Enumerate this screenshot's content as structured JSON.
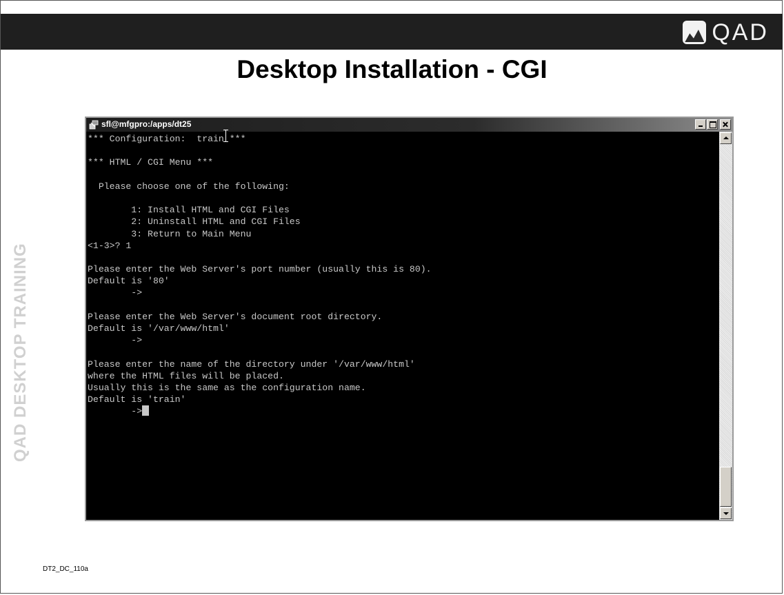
{
  "header": {
    "logo_text": "QAD",
    "logo_icon": "qad-mountain-logo-icon"
  },
  "slide": {
    "title": "Desktop Installation - CGI",
    "side_label": "QAD DESKTOP TRAINING",
    "footer_code": "DT2_DC_110a"
  },
  "window": {
    "title": "sfl@mfgpro:/apps/dt25",
    "icon": "putty-terminal-icon",
    "buttons": [
      "minimize",
      "maximize",
      "close"
    ]
  },
  "terminal": {
    "lines": [
      "*** Configuration:  train ***",
      "",
      "*** HTML / CGI Menu ***",
      "",
      "  Please choose one of the following:",
      "",
      "        1: Install HTML and CGI Files",
      "        2: Uninstall HTML and CGI Files",
      "        3: Return to Main Menu",
      "<1-3>? 1",
      "",
      "Please enter the Web Server's port number (usually this is 80).",
      "Default is '80'",
      "        ->",
      "",
      "Please enter the Web Server's document root directory.",
      "Default is '/var/www/html'",
      "        ->",
      "",
      "Please enter the name of the directory under '/var/www/html'",
      "where the HTML files will be placed.",
      "Usually this is the same as the configuration name.",
      "Default is 'train'",
      "        ->"
    ]
  },
  "colors": {
    "header_bar": "#1f1f1f",
    "terminal_bg": "#000000",
    "terminal_fg": "#c8c8c8",
    "side_label": "#d0d0d0"
  }
}
